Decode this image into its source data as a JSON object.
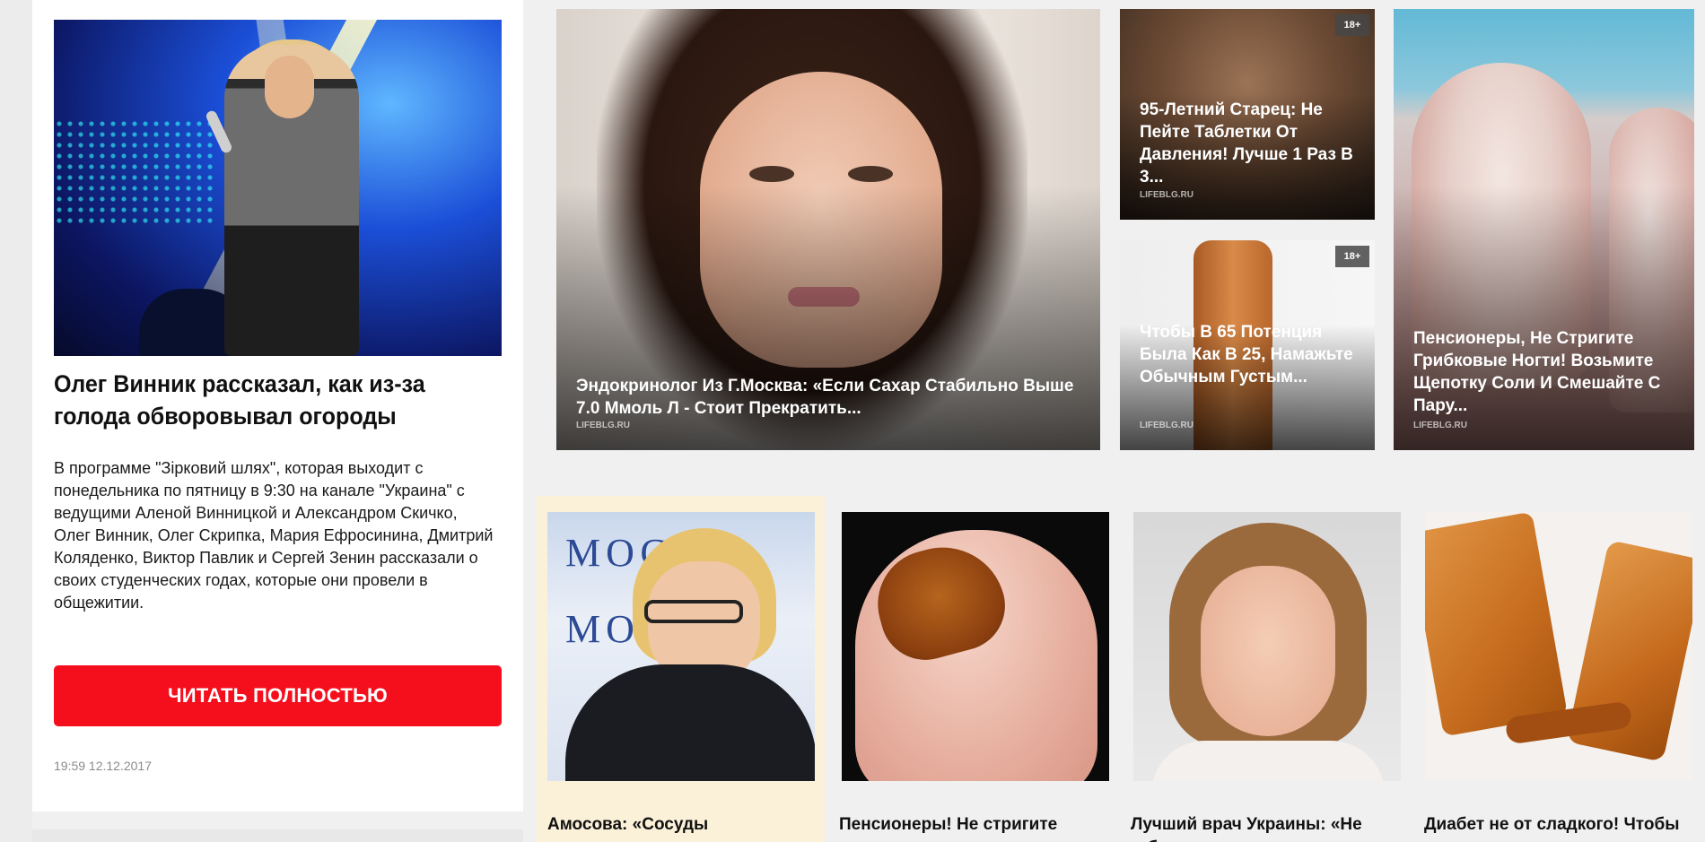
{
  "article": {
    "title": "Олег Винник рассказал, как из-за голода обворовывал огороды",
    "text": "В программе \"Зірковий шлях\", которая выходит с понедельника по пятницу в 9:30 на канале \"Украина\" с ведущими Аленой Винницкой и Александром Скичко, Олег Винник, Олег Скрипка, Мария Ефросинина, Дмитрий Коляденко, Виктор Павлик и Сергей Зенин рассказали о своих студенческих годах, которые они провели в общежитии.",
    "button_label": "ЧИТАТЬ ПОЛНОСТЬЮ",
    "timestamp": "19:59 12.12.2017"
  },
  "top_tiles": [
    {
      "title": "Эндокринолог Из Г.Москва: «Если Сахар Стабильно Выше 7.0 Ммоль Л - Стоит Прекратить...",
      "source": "LIFEBLG.RU",
      "badge": ""
    },
    {
      "title": "95-Летний Старец: Не Пейте Таблетки От Давления! Лучше 1 Раз В 3...",
      "source": "LIFEBLG.RU",
      "badge": "18+"
    },
    {
      "title": "Чтобы В 65 Потенция Была Как В 25, Намажьте Обычным Густым...",
      "source": "LIFEBLG.RU",
      "badge": "18+"
    },
    {
      "title": "Пенсионеры, Не Стригите Грибковые Ногти! Возьмите Щепотку Соли И Смешайте С Пару...",
      "source": "LIFEBLG.RU",
      "badge": ""
    }
  ],
  "bottom_cards": [
    {
      "title": "Амосова: «Сосуды прочистятся",
      "logo_text": "МОС"
    },
    {
      "title": "Пенсионеры! Не стригите"
    },
    {
      "title": "Лучший врач Украины: «Не губите"
    },
    {
      "title": "Диабет не от сладкого! Чтобы"
    }
  ],
  "colors": {
    "button": "#f50f1d",
    "highlight_card": "#fbf1d8",
    "background": "#f0f0f0"
  }
}
